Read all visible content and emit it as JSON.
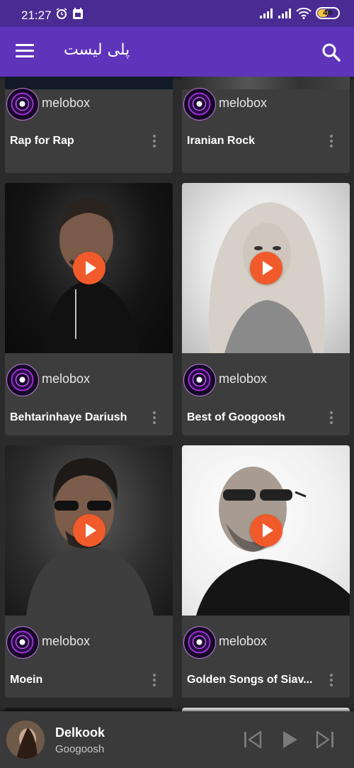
{
  "status_bar": {
    "time": "21:27",
    "battery": "46"
  },
  "app_bar": {
    "title": "پلی لیست"
  },
  "cards": [
    {
      "channel": "melobox",
      "title": "Rap for Rap"
    },
    {
      "channel": "melobox",
      "title": "Iranian Rock"
    },
    {
      "channel": "melobox",
      "title": "Behtarinhaye Dariush"
    },
    {
      "channel": "melobox",
      "title": "Best of Googoosh"
    },
    {
      "channel": "melobox",
      "title": "Moein"
    },
    {
      "channel": "melobox",
      "title": "Golden Songs of Siav..."
    }
  ],
  "player": {
    "song": "Delkook",
    "artist": "Googoosh"
  },
  "icons": {
    "menu": "menu-icon",
    "search": "search-icon",
    "more": "more-vert-icon",
    "play": "play-icon",
    "previous": "skip-previous-icon",
    "next": "skip-next-icon"
  },
  "colors": {
    "status_bar": "#4a2b93",
    "app_bar": "#5e34ba",
    "background": "#2b2b2b",
    "card": "#3d3d3d",
    "play_button": "#f15a2a"
  }
}
